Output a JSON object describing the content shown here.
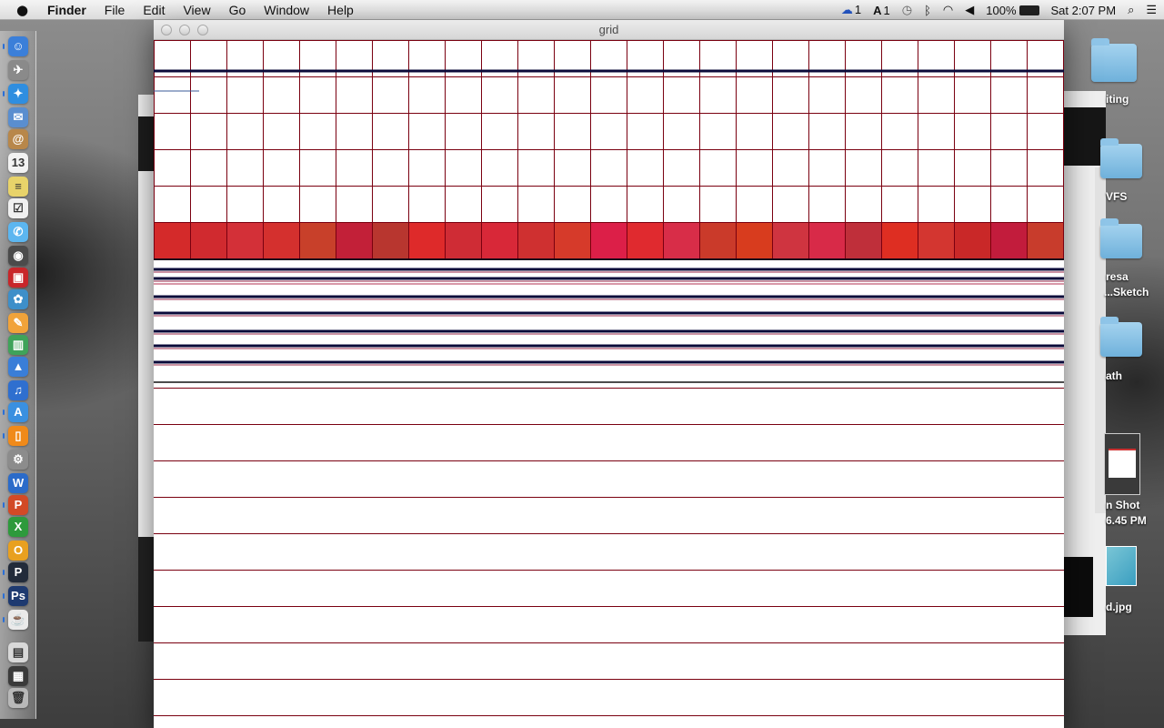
{
  "menubar": {
    "apple_icon": "apple-icon",
    "app_name": "Finder",
    "menus": [
      "File",
      "Edit",
      "View",
      "Go",
      "Window",
      "Help"
    ],
    "status": {
      "cc_count": "1",
      "a_count": "1",
      "battery": "100%",
      "clock": "Sat 2:07 PM"
    }
  },
  "window": {
    "title": "grid"
  },
  "grid": {
    "cell_color": "#7a0010",
    "dark_line_color": "#0a0a3a",
    "red_row_colors": [
      "#d42a2a",
      "#d02a2f",
      "#d33038",
      "#d4302e",
      "#c8402a",
      "#c22038",
      "#b8362f",
      "#de2a2a",
      "#cf2c35",
      "#d82838",
      "#cf3030",
      "#d63a2a",
      "#dc1f48",
      "#e02a2f",
      "#d82d48",
      "#ca3a2a",
      "#d83c1e",
      "#cf3440",
      "#d82a48",
      "#bf2f3a",
      "#de2e22",
      "#d33630",
      "#c92828",
      "#c21c3c",
      "#c83c2c"
    ]
  },
  "desktop": {
    "files": [
      "iting",
      "VFS",
      "resa",
      "...Sketch",
      "ath",
      "n Shot",
      "6.45 PM",
      "d.jpg"
    ]
  },
  "dock": {
    "items": [
      {
        "icon": "finder-icon",
        "glyph": "☺",
        "color": "#3b7fd9"
      },
      {
        "icon": "launchpad-icon",
        "glyph": "✈",
        "color": "#8a8a8a"
      },
      {
        "icon": "safari-icon",
        "glyph": "✦",
        "color": "#2f8ee0"
      },
      {
        "icon": "mail-icon",
        "glyph": "✉",
        "color": "#5a8ecf"
      },
      {
        "icon": "contacts-icon",
        "glyph": "@",
        "color": "#b8874a"
      },
      {
        "icon": "calendar-icon",
        "glyph": "13",
        "color": "#f2f2f2"
      },
      {
        "icon": "notes-icon",
        "glyph": "≡",
        "color": "#e8d36a"
      },
      {
        "icon": "reminders-icon",
        "glyph": "☑",
        "color": "#f0f0f0"
      },
      {
        "icon": "messages-icon",
        "glyph": "✆",
        "color": "#5cb6f0"
      },
      {
        "icon": "facetime-icon",
        "glyph": "◉",
        "color": "#4b4b4b"
      },
      {
        "icon": "photobooth-icon",
        "glyph": "▣",
        "color": "#c8262a"
      },
      {
        "icon": "iphoto-icon",
        "glyph": "✿",
        "color": "#3e8fc9"
      },
      {
        "icon": "pages-icon",
        "glyph": "✎",
        "color": "#f1a33a"
      },
      {
        "icon": "numbers-icon",
        "glyph": "▥",
        "color": "#3fa35a"
      },
      {
        "icon": "keynote-icon",
        "glyph": "▲",
        "color": "#3a7ed8"
      },
      {
        "icon": "itunes-icon",
        "glyph": "♫",
        "color": "#2f6fcf"
      },
      {
        "icon": "appstore-icon",
        "glyph": "A",
        "color": "#3a90e0"
      },
      {
        "icon": "ibooks-icon",
        "glyph": "▯",
        "color": "#f08a1a"
      },
      {
        "icon": "systemprefs-icon",
        "glyph": "⚙",
        "color": "#8c8c8c"
      },
      {
        "icon": "word-icon",
        "glyph": "W",
        "color": "#2b6bc9"
      },
      {
        "icon": "powerpoint-icon",
        "glyph": "P",
        "color": "#d24a26"
      },
      {
        "icon": "excel-icon",
        "glyph": "X",
        "color": "#2e9a3c"
      },
      {
        "icon": "outlook-icon",
        "glyph": "O",
        "color": "#e8a020"
      },
      {
        "icon": "processing-icon",
        "glyph": "P",
        "color": "#222b3a"
      },
      {
        "icon": "photoshop-icon",
        "glyph": "Ps",
        "color": "#1e3a70"
      },
      {
        "icon": "java-icon",
        "glyph": "☕",
        "color": "#eaeaea"
      },
      {
        "icon": "preview-icon",
        "glyph": "▤",
        "color": "#d8d8d8"
      },
      {
        "icon": "imagecapture-icon",
        "glyph": "▦",
        "color": "#3a3a3a"
      },
      {
        "icon": "trash-icon",
        "glyph": "🗑",
        "color": "#b8b8b8"
      }
    ]
  }
}
